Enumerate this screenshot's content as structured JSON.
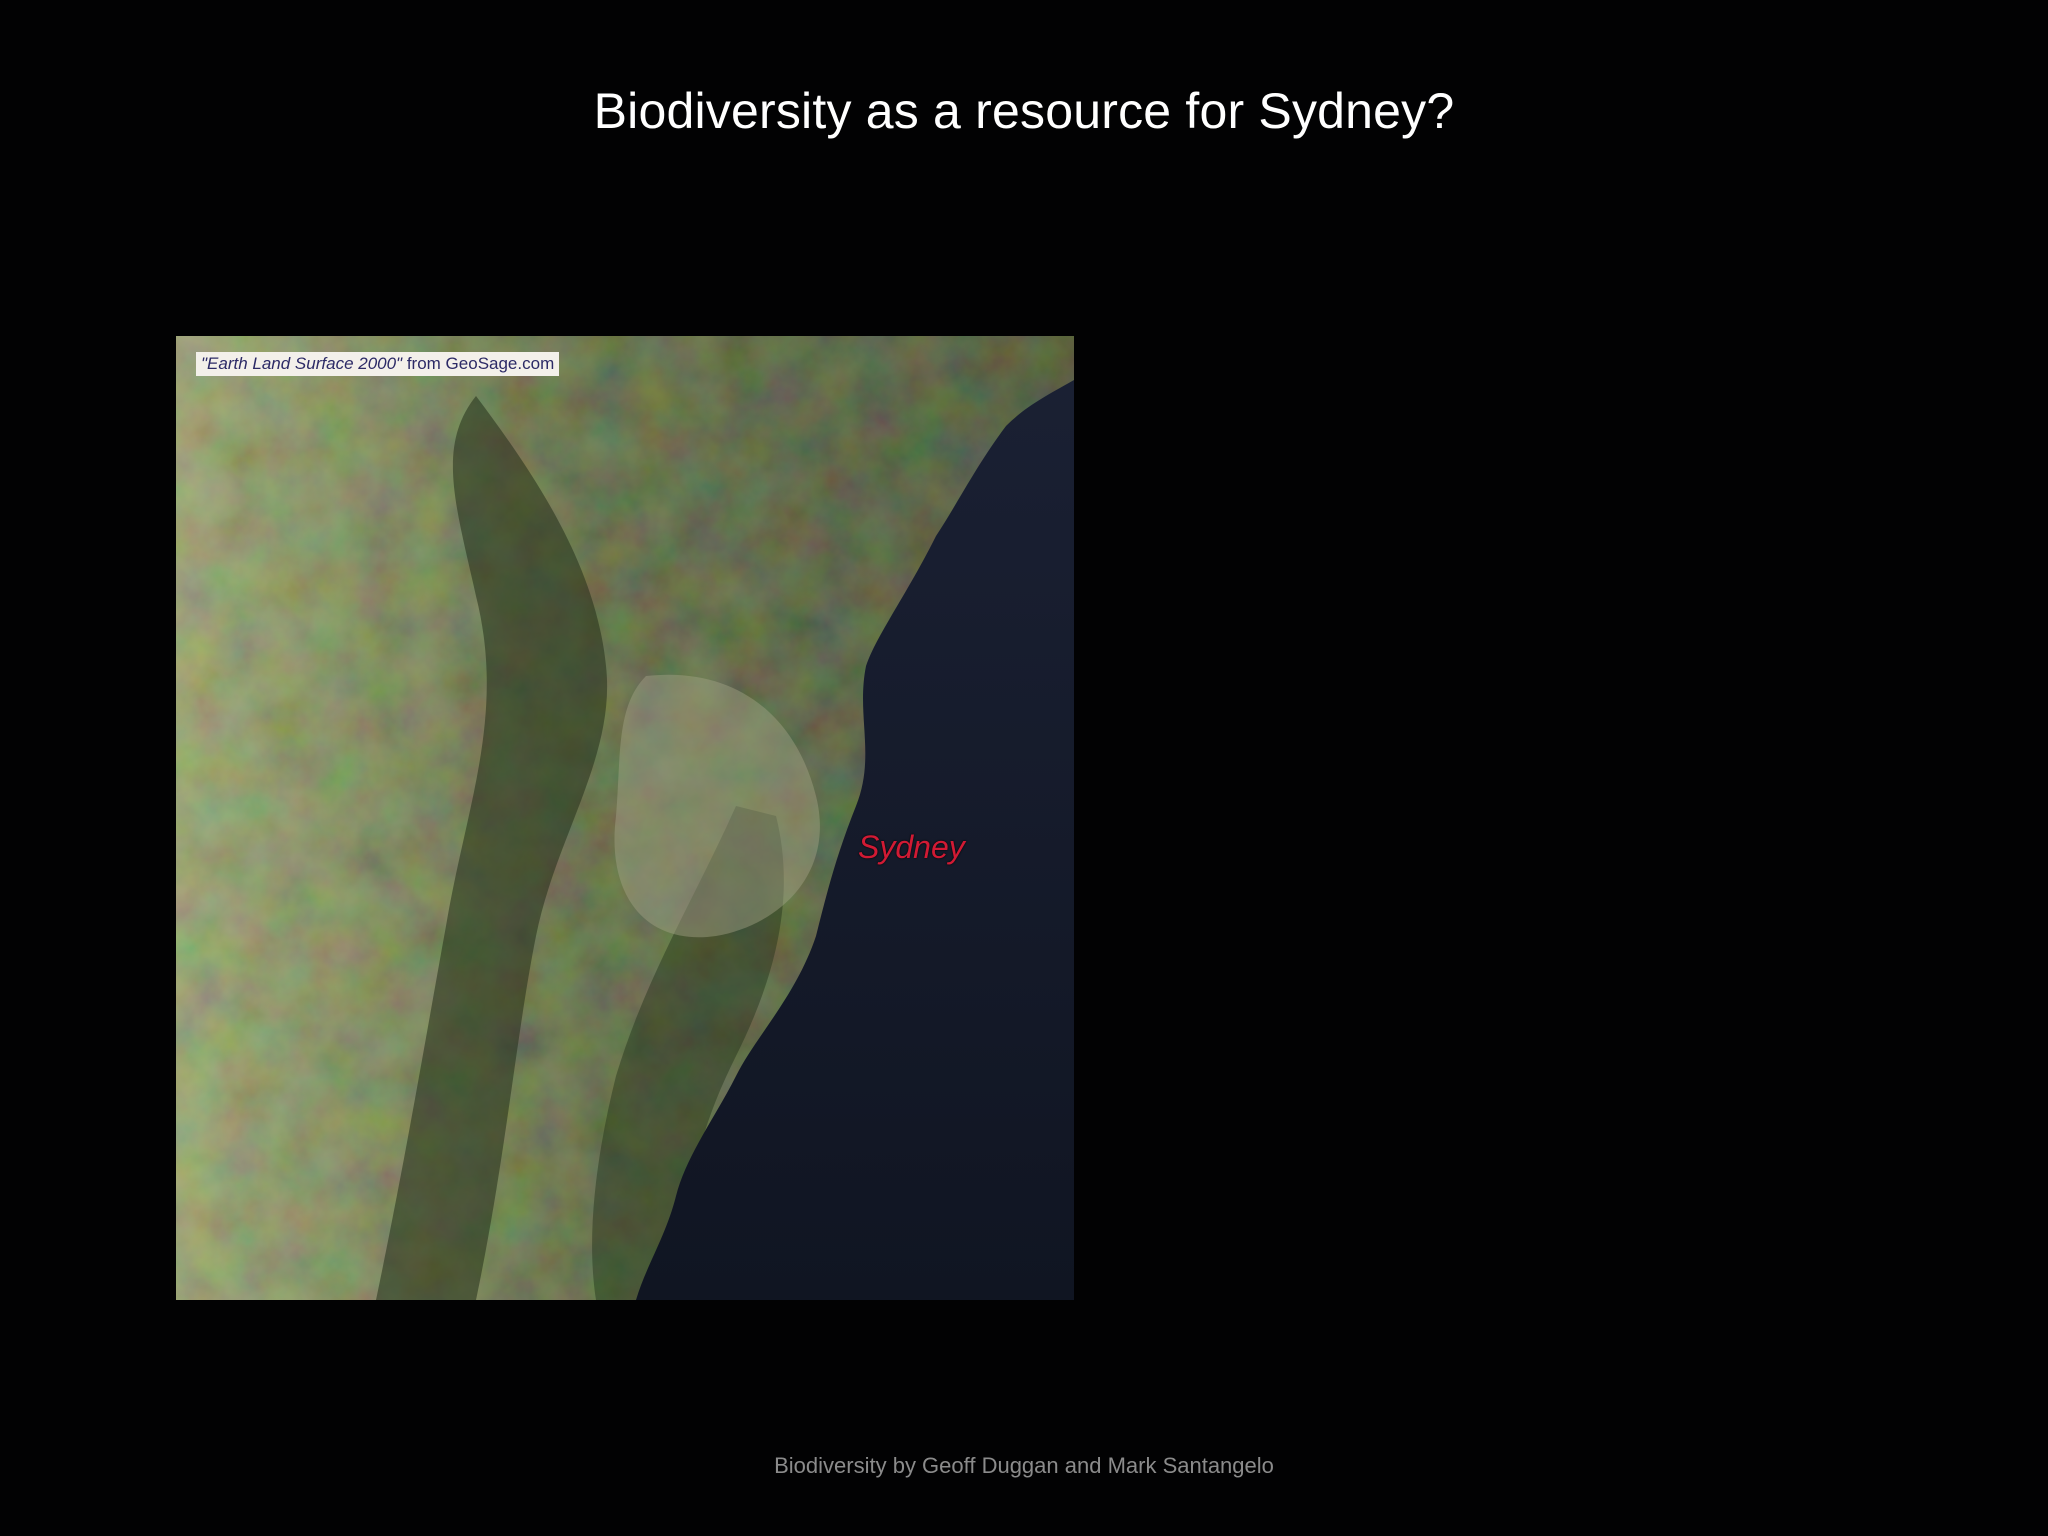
{
  "slide": {
    "title": "Biodiversity as a resource for Sydney?",
    "footer": "Biodiversity by Geoff Duggan and Mark Santangelo"
  },
  "map": {
    "credit_quoted": "\"Earth Land Surface 2000\"",
    "credit_source": " from GeoSage.com",
    "city_label": "Sydney",
    "colors": {
      "land_light": "#8c9566",
      "land_dark": "#2f3a22",
      "ocean": "#14192a",
      "label": "#d11a34"
    }
  }
}
